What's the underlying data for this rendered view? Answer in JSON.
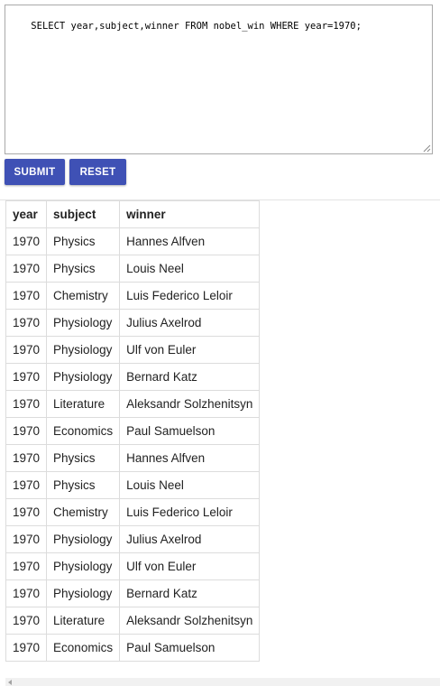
{
  "query": {
    "text": "SELECT year,subject,winner FROM nobel_win WHERE year=1970;"
  },
  "buttons": {
    "submit_label": "SUBMIT",
    "reset_label": "RESET",
    "color": "#3f51b5"
  },
  "results": {
    "columns": [
      "year",
      "subject",
      "winner"
    ],
    "rows": [
      [
        "1970",
        "Physics",
        "Hannes Alfven"
      ],
      [
        "1970",
        "Physics",
        "Louis Neel"
      ],
      [
        "1970",
        "Chemistry",
        "Luis Federico Leloir"
      ],
      [
        "1970",
        "Physiology",
        "Julius Axelrod"
      ],
      [
        "1970",
        "Physiology",
        "Ulf von Euler"
      ],
      [
        "1970",
        "Physiology",
        "Bernard Katz"
      ],
      [
        "1970",
        "Literature",
        "Aleksandr Solzhenitsyn"
      ],
      [
        "1970",
        "Economics",
        "Paul Samuelson"
      ],
      [
        "1970",
        "Physics",
        "Hannes Alfven"
      ],
      [
        "1970",
        "Physics",
        "Louis Neel"
      ],
      [
        "1970",
        "Chemistry",
        "Luis Federico Leloir"
      ],
      [
        "1970",
        "Physiology",
        "Julius Axelrod"
      ],
      [
        "1970",
        "Physiology",
        "Ulf von Euler"
      ],
      [
        "1970",
        "Physiology",
        "Bernard Katz"
      ],
      [
        "1970",
        "Literature",
        "Aleksandr Solzhenitsyn"
      ],
      [
        "1970",
        "Economics",
        "Paul Samuelson"
      ]
    ]
  }
}
